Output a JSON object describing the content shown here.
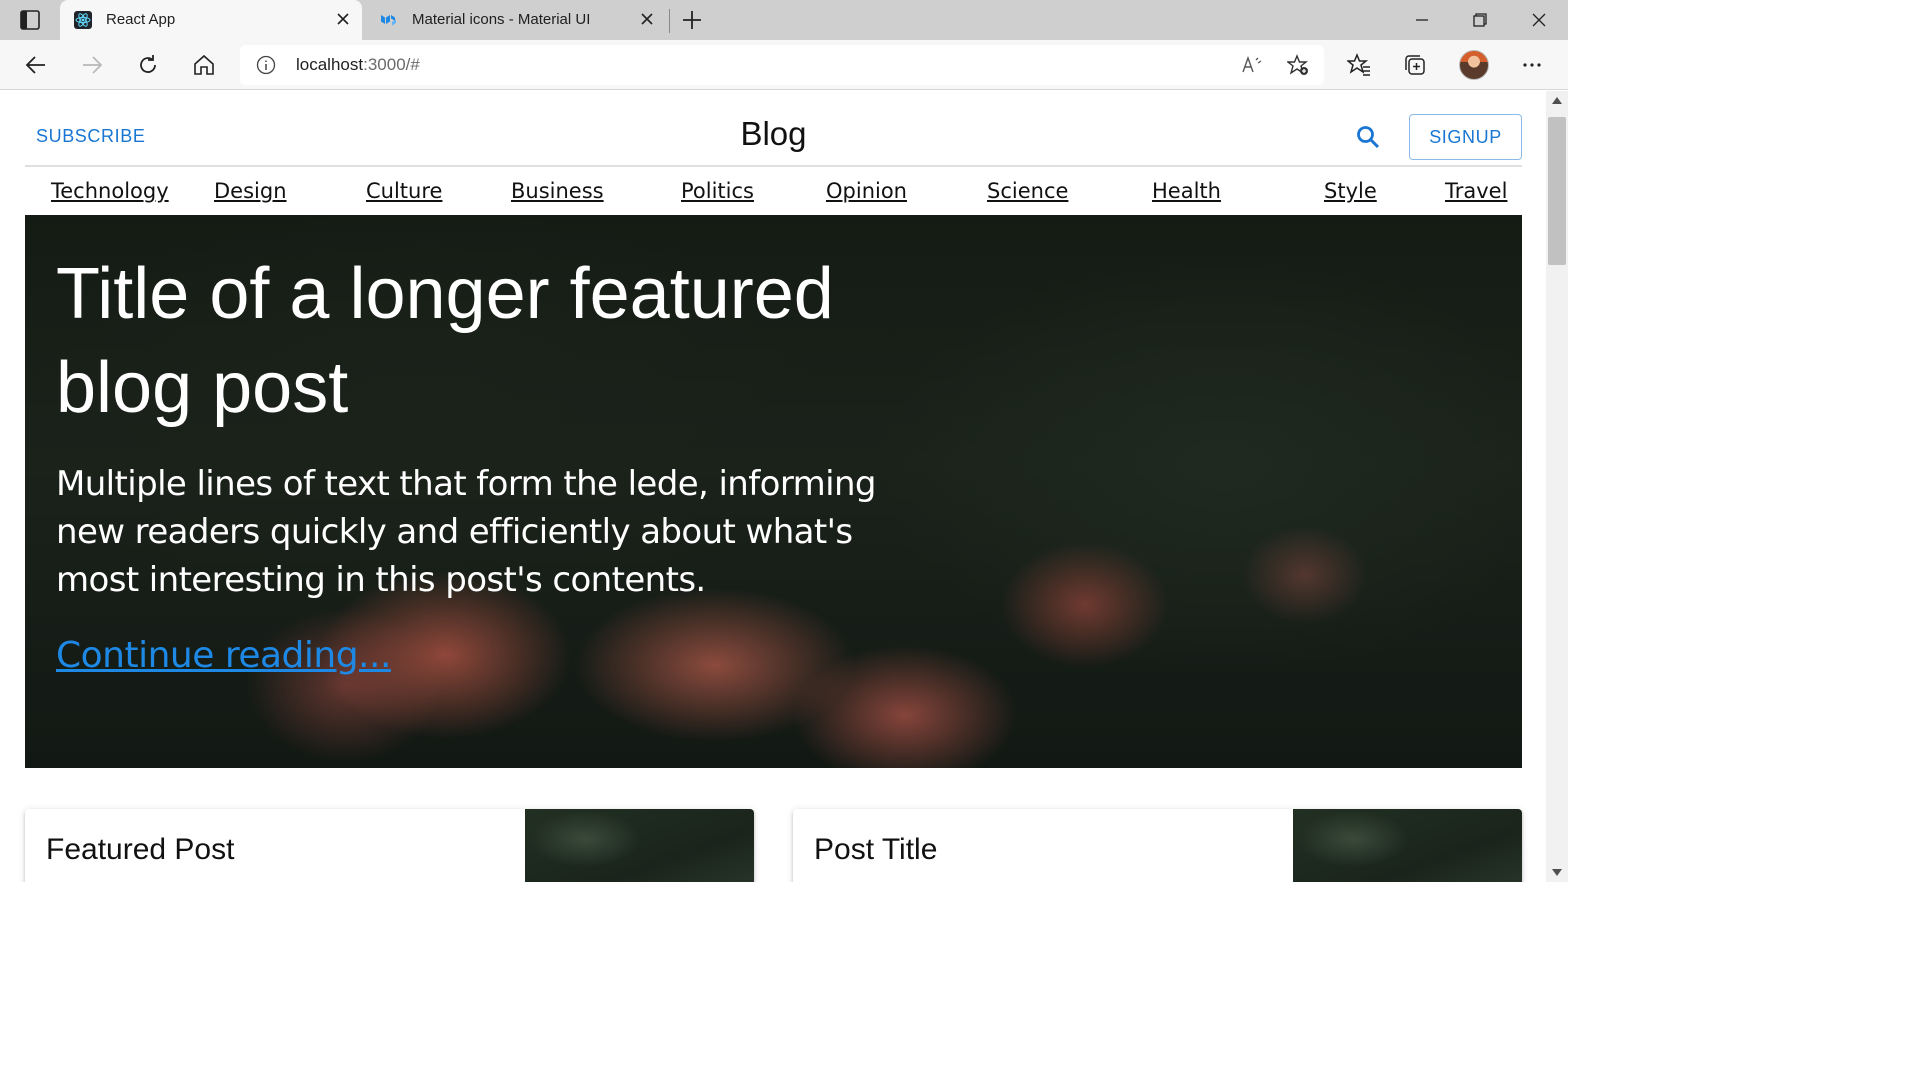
{
  "browser": {
    "tabs": [
      {
        "title": "React App",
        "active": true,
        "icon": "react-icon"
      },
      {
        "title": "Material icons - Material UI",
        "active": false,
        "icon": "mui-icon"
      }
    ],
    "address": {
      "host": "localhost",
      "path": ":3000/#"
    }
  },
  "header": {
    "subscribe_label": "SUBSCRIBE",
    "title": "Blog",
    "signup_label": "SIGNUP"
  },
  "sections": [
    "Technology",
    "Design",
    "Culture",
    "Business",
    "Politics",
    "Opinion",
    "Science",
    "Health",
    "Style",
    "Travel"
  ],
  "main_featured": {
    "title": "Title of a longer featured blog post",
    "description": "Multiple lines of text that form the lede, informing new readers quickly and efficiently about what's most interesting in this post's contents.",
    "link_text": "Continue reading..."
  },
  "cards": [
    {
      "title": "Featured Post"
    },
    {
      "title": "Post Title"
    }
  ],
  "colors": {
    "primary": "#1976d2",
    "link": "#1e88e5"
  }
}
